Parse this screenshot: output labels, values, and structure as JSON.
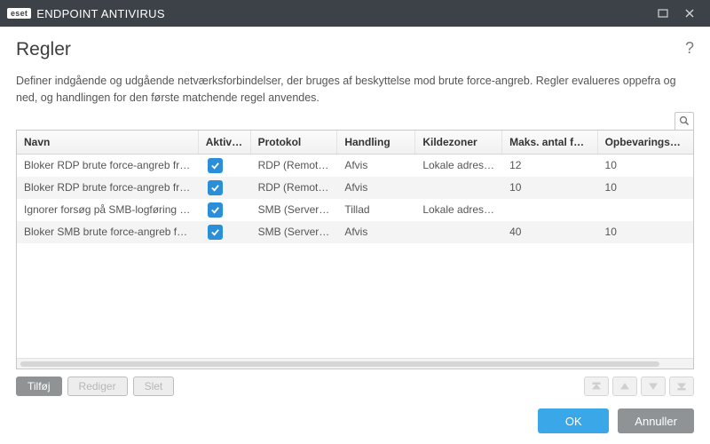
{
  "titlebar": {
    "brand_badge": "eset",
    "brand_text": "ENDPOINT ANTIVIRUS"
  },
  "page_title": "Regler",
  "help_glyph": "?",
  "description": "Definer indgående og udgående netværksforbindelser, der bruges af beskyttelse mod brute force-angreb. Regler evalueres oppefra og ned, og handlingen for den første matchende regel anvendes.",
  "columns": {
    "name": "Navn",
    "enabled": "Aktiveret",
    "protocol": "Protokol",
    "action": "Handling",
    "source_zones": "Kildezoner",
    "max_attempts": "Maks. antal forsøg",
    "retention": "Opbevaringsperiode"
  },
  "rows": [
    {
      "name": "Bloker RDP brute force-angreb fra ...",
      "enabled": true,
      "protocol": "RDP (Remote...",
      "action": "Afvis",
      "source_zones": "Lokale adress...",
      "max_attempts": "12",
      "retention": "10"
    },
    {
      "name": "Bloker RDP brute force-angreb fra ...",
      "enabled": true,
      "protocol": "RDP (Remote...",
      "action": "Afvis",
      "source_zones": "",
      "max_attempts": "10",
      "retention": "10"
    },
    {
      "name": "Ignorer forsøg på SMB-logføring f...",
      "enabled": true,
      "protocol": "SMB (Server ...",
      "action": "Tillad",
      "source_zones": "Lokale adress...",
      "max_attempts": "",
      "retention": ""
    },
    {
      "name": "Bloker SMB brute force-angreb fra ...",
      "enabled": true,
      "protocol": "SMB (Server ...",
      "action": "Afvis",
      "source_zones": "",
      "max_attempts": "40",
      "retention": "10"
    }
  ],
  "actions": {
    "add": "Tilføj",
    "edit": "Rediger",
    "delete": "Slet"
  },
  "footer": {
    "ok": "OK",
    "cancel": "Annuller"
  }
}
